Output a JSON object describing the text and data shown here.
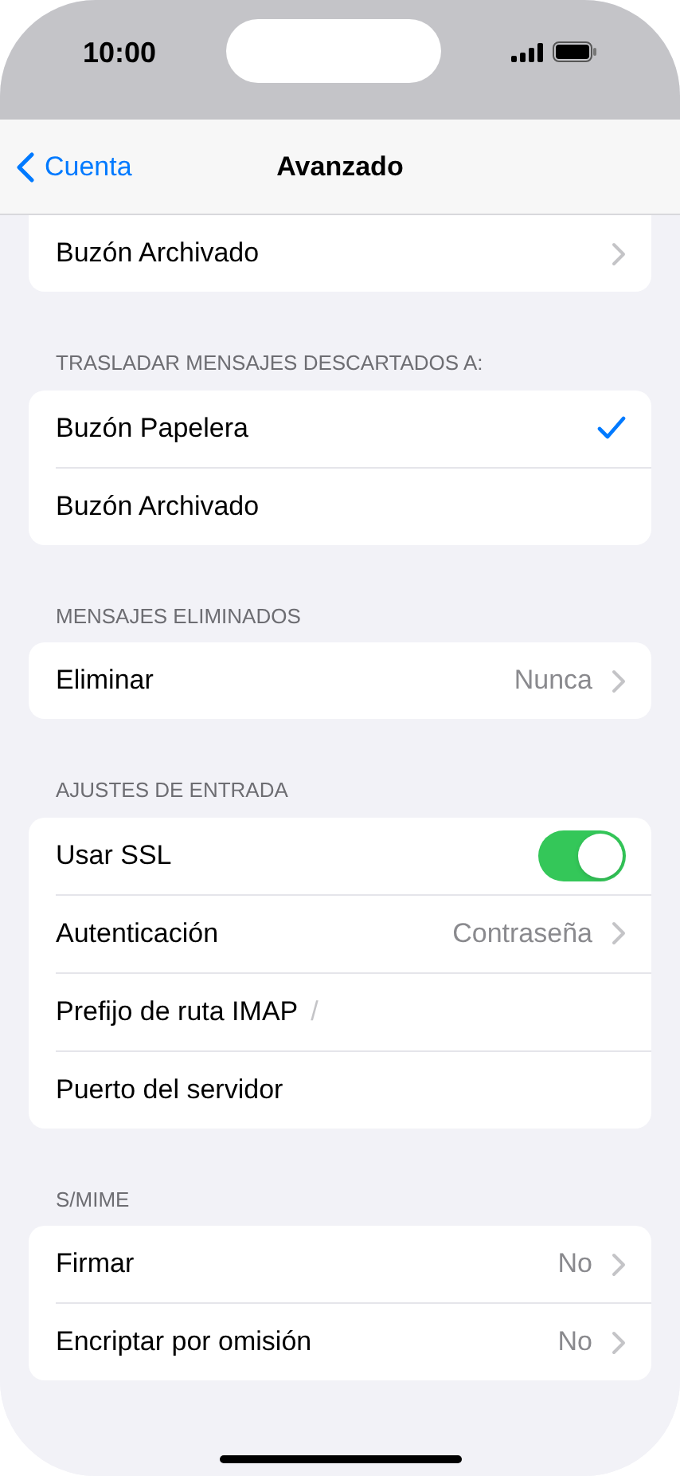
{
  "status_bar": {
    "time": "10:00"
  },
  "nav": {
    "back": "Cuenta",
    "title": "Avanzado"
  },
  "groups": [
    {
      "rows": [
        {
          "kind": "chevron",
          "label": "Buzón Archivado"
        }
      ]
    },
    {
      "header": "TRASLADAR MENSAJES DESCARTADOS A:",
      "rows": [
        {
          "kind": "check",
          "label": "Buzón Papelera",
          "selected": true
        },
        {
          "kind": "check",
          "label": "Buzón Archivado",
          "selected": false
        }
      ]
    },
    {
      "header": "MENSAJES ELIMINADOS",
      "rows": [
        {
          "kind": "chevron",
          "label": "Eliminar",
          "value": "Nunca"
        }
      ]
    },
    {
      "header": "AJUSTES DE ENTRADA",
      "rows": [
        {
          "kind": "toggle",
          "label": "Usar SSL",
          "on": true
        },
        {
          "kind": "chevron",
          "label": "Autenticación",
          "value": "Contraseña"
        },
        {
          "kind": "field",
          "label": "Prefijo de ruta IMAP",
          "placeholder": "/"
        },
        {
          "kind": "field",
          "label": "Puerto del servidor"
        }
      ]
    },
    {
      "header": "S/MIME",
      "rows": [
        {
          "kind": "chevron",
          "label": "Firmar",
          "value": "No"
        },
        {
          "kind": "chevron",
          "label": "Encriptar por omisión",
          "value": "No"
        }
      ]
    }
  ]
}
